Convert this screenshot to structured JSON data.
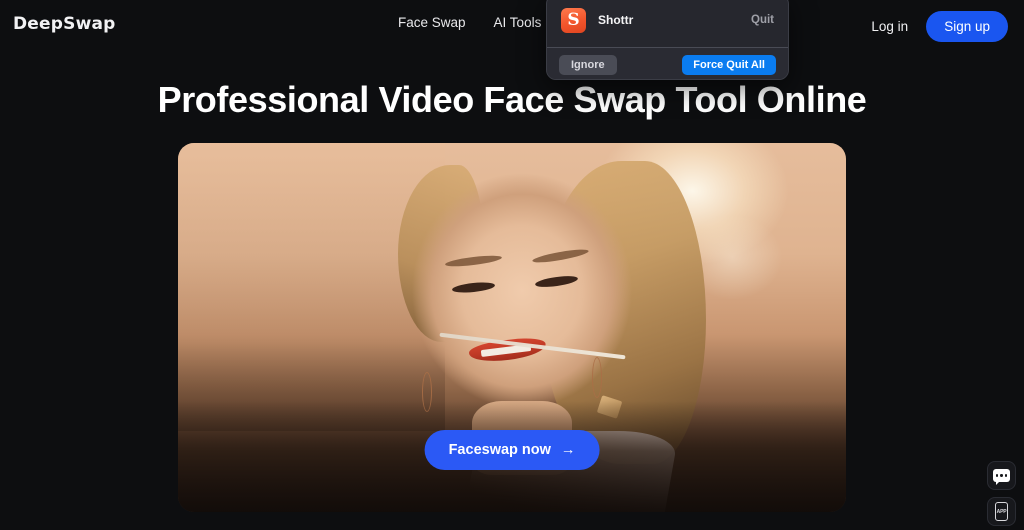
{
  "header": {
    "logo": "DeepSwap",
    "nav": [
      {
        "label": "Face Swap",
        "has_caret": false
      },
      {
        "label": "AI Tools",
        "has_caret": true
      }
    ],
    "login_label": "Log in",
    "signup_label": "Sign up"
  },
  "hero": {
    "title": "Professional Video Face Swap Tool Online",
    "cta_label": "Faceswap now",
    "cta_arrow": "→"
  },
  "widgets": {
    "chat_icon": "chat-bubble-icon",
    "app_icon_label": "APP"
  },
  "force_quit_dialog": {
    "app_icon_letter": "S",
    "app_name": "Shottr",
    "quit_label": "Quit",
    "ignore_label": "Ignore",
    "force_quit_all_label": "Force Quit All"
  },
  "colors": {
    "page_bg": "#0d0e10",
    "accent_blue": "#1a56f0",
    "cta_blue": "#2b59f5",
    "mac_blue": "#0a7cf0",
    "shottr_orange": "#f2552c"
  }
}
